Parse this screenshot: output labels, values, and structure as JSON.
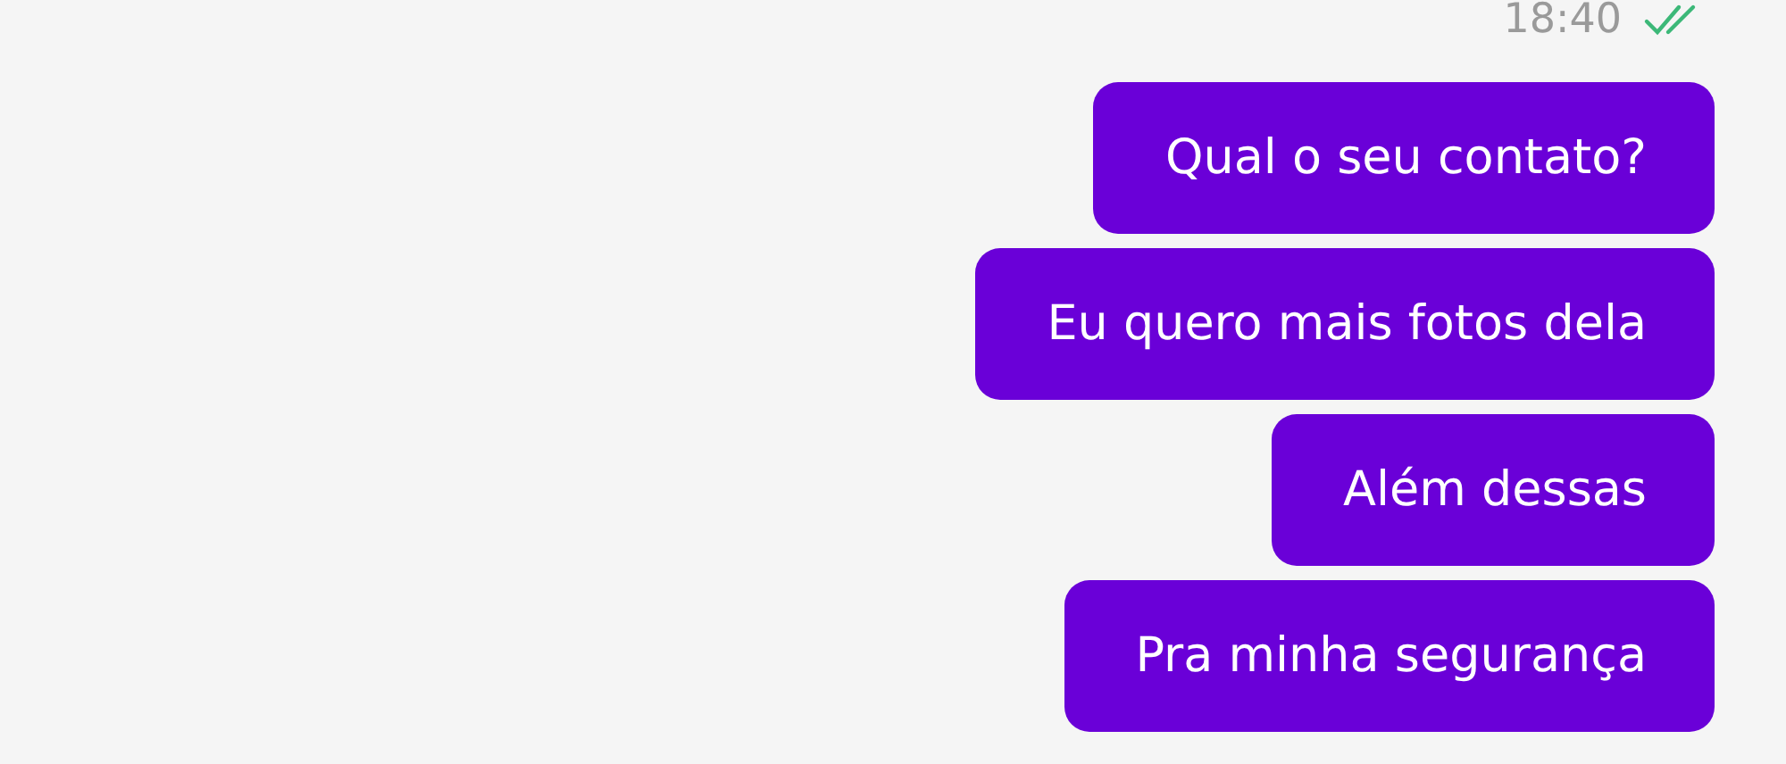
{
  "header": {
    "time": "18:40",
    "read": true
  },
  "messages": [
    {
      "text": "Qual o seu contato?"
    },
    {
      "text": "Eu quero mais fotos dela"
    },
    {
      "text": "Além dessas"
    },
    {
      "text": "Pra minha segurança"
    }
  ]
}
